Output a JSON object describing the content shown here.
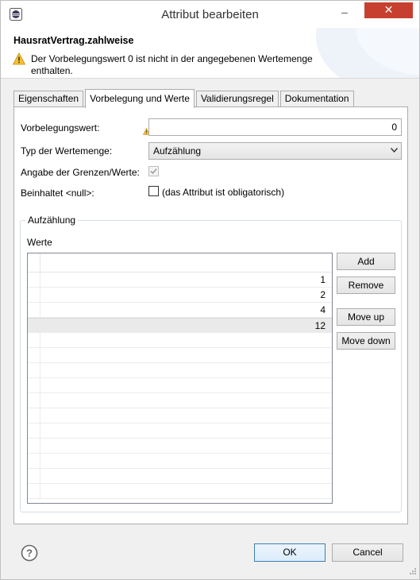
{
  "window": {
    "title": "Attribut bearbeiten",
    "app_icon": "eclipse-icon",
    "minimize_label": "–",
    "close_label": "✕"
  },
  "header": {
    "title": "HausratVertrag.zahlweise",
    "warning_icon": "warning-icon",
    "message": "Der Vorbelegungswert 0 ist nicht in der angegebenen Wertemenge enthalten."
  },
  "tabs": [
    {
      "label": "Eigenschaften",
      "active": false
    },
    {
      "label": "Vorbelegung und Werte",
      "active": true
    },
    {
      "label": "Validierungsregel",
      "active": false
    },
    {
      "label": "Dokumentation",
      "active": false
    }
  ],
  "form": {
    "default_label": "Vorbelegungswert:",
    "default_value": "0",
    "type_label": "Typ der Wertemenge:",
    "type_value": "Aufzählung",
    "bounds_label": "Angabe der Grenzen/Werte:",
    "bounds_checked": true,
    "null_label": "Beinhaltet <null>:",
    "null_checkbox_text": "(das Attribut ist obligatorisch)",
    "null_checked": false
  },
  "enumeration": {
    "group_title": "Aufzählung",
    "values_label": "Werte",
    "values": [
      "1",
      "2",
      "4",
      "12"
    ],
    "selected_index": 3,
    "buttons": {
      "add": "Add",
      "remove": "Remove",
      "move_up": "Move up",
      "move_down": "Move down"
    }
  },
  "footer": {
    "help_icon": "help-icon",
    "ok_label": "OK",
    "cancel_label": "Cancel"
  },
  "colors": {
    "close_button": "#c7402f",
    "warning": "#e8a000",
    "ok_border": "#3c7fb1"
  }
}
